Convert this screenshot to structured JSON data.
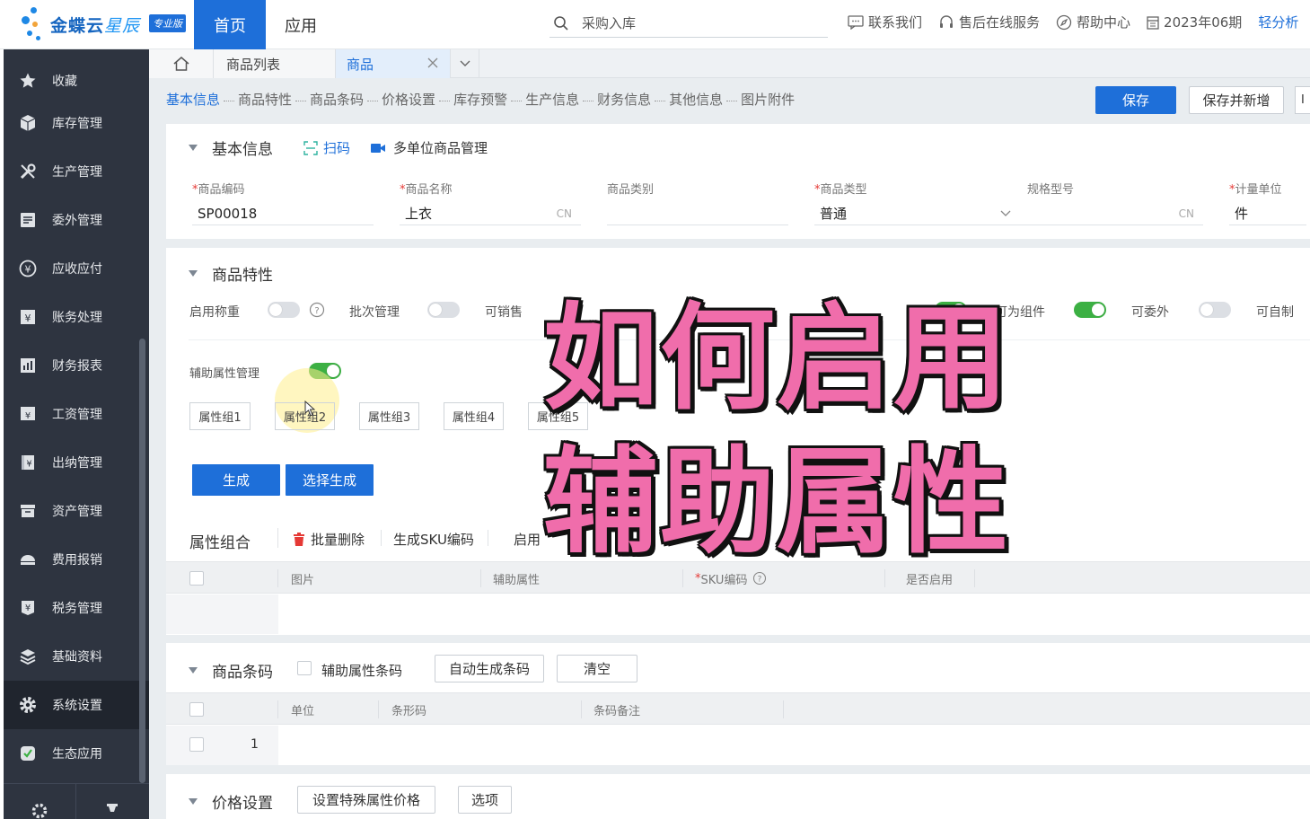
{
  "header": {
    "brand": "金蝶云",
    "brand_light": "星辰",
    "badge": "专业版",
    "nav_home": "首页",
    "nav_app": "应用",
    "search_text": "采购入库",
    "links": [
      "联系我们",
      "售后在线服务",
      "帮助中心",
      "2023年06期",
      "轻分析"
    ]
  },
  "sidebar": {
    "items": [
      {
        "label": "收藏",
        "icon": "star-icon"
      },
      {
        "label": "库存管理",
        "icon": "cube-icon"
      },
      {
        "label": "生产管理",
        "icon": "wrench-icon"
      },
      {
        "label": "委外管理",
        "icon": "document-icon"
      },
      {
        "label": "应收应付",
        "icon": "yen-circle-icon"
      },
      {
        "label": "账务处理",
        "icon": "ledger-icon"
      },
      {
        "label": "财务报表",
        "icon": "report-icon"
      },
      {
        "label": "工资管理",
        "icon": "salary-icon"
      },
      {
        "label": "出纳管理",
        "icon": "cashier-icon"
      },
      {
        "label": "资产管理",
        "icon": "asset-icon"
      },
      {
        "label": "费用报销",
        "icon": "expense-icon"
      },
      {
        "label": "税务管理",
        "icon": "tax-icon"
      },
      {
        "label": "基础资料",
        "icon": "layers-icon"
      },
      {
        "label": "系统设置",
        "icon": "gear-icon"
      },
      {
        "label": "生态应用",
        "icon": "eco-icon"
      }
    ]
  },
  "tabs": {
    "list": "商品列表",
    "current": "商品"
  },
  "anchors": [
    "基本信息",
    "商品特性",
    "商品条码",
    "价格设置",
    "库存预警",
    "生产信息",
    "财务信息",
    "其他信息",
    "图片附件"
  ],
  "toolbar": {
    "save": "保存",
    "save_new": "保存并新增",
    "edge": "I"
  },
  "basic": {
    "title": "基本信息",
    "scan": "扫码",
    "multi_unit": "多单位商品管理",
    "fields": [
      {
        "label": "商品编码",
        "value": "SP00018",
        "required": true
      },
      {
        "label": "商品名称",
        "value": "上衣",
        "required": true,
        "suffix": "CN"
      },
      {
        "label": "商品类别",
        "value": "",
        "required": false
      },
      {
        "label": "商品类型",
        "value": "普通",
        "required": true
      },
      {
        "label": "规格型号",
        "value": "",
        "required": false,
        "suffix": "CN"
      },
      {
        "label": "计量单位",
        "value": "件",
        "required": true
      }
    ]
  },
  "features": {
    "title": "商品特性",
    "switches": [
      {
        "label": "启用称重",
        "on": false
      },
      {
        "label": "批次管理",
        "on": false
      },
      {
        "label": "可销售",
        "on": true
      },
      {
        "label": "可为组件",
        "on": true
      },
      {
        "label": "可委外",
        "on": false
      },
      {
        "label": "可自制",
        "on": false
      }
    ],
    "aux_label": "辅助属性管理",
    "aux_on": true,
    "attr_groups": [
      "属性组1",
      "属性组2",
      "属性组3",
      "属性组4",
      "属性组5"
    ],
    "generate": "生成",
    "select_generate": "选择生成"
  },
  "combo": {
    "title": "属性组合",
    "batch_delete": "批量删除",
    "gen_sku": "生成SKU编码",
    "enable": "启用",
    "columns": [
      "图片",
      "辅助属性",
      "SKU编码",
      "是否启用"
    ]
  },
  "barcode": {
    "title": "商品条码",
    "aux_barcode": "辅助属性条码",
    "auto_gen": "自动生成条码",
    "clear": "清空",
    "columns": [
      "单位",
      "条形码",
      "条码备注"
    ],
    "row_no": "1"
  },
  "price": {
    "title": "价格设置",
    "special": "设置特殊属性价格",
    "options": "选项"
  },
  "overlay": {
    "line1": "如何启用",
    "line2": "辅助属性"
  },
  "colors": {
    "accent": "#1e6fd9",
    "sidebar": "#2e3440",
    "switch_on": "#3cb043",
    "overlay": "#f06dab"
  }
}
